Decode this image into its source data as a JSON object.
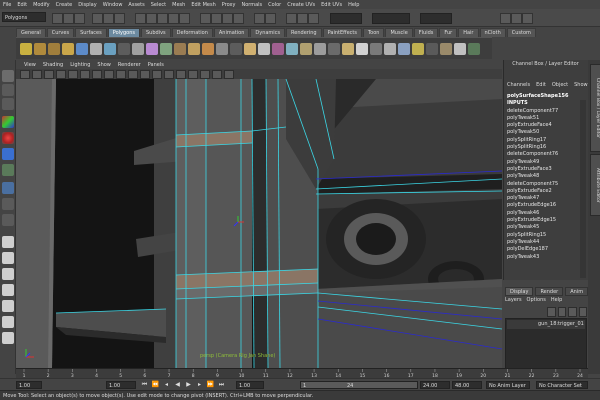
{
  "menubar": {
    "items": [
      "File",
      "Edit",
      "Modify",
      "Create",
      "Display",
      "Window",
      "Assets",
      "Select",
      "Mesh",
      "Edit Mesh",
      "Proxy",
      "Normals",
      "Color",
      "Create UVs",
      "Edit UVs",
      "Help"
    ]
  },
  "statusline": {
    "mode": "Polygons"
  },
  "shelf": {
    "tabs": [
      "General",
      "Curves",
      "Surfaces",
      "Polygons",
      "Subdivs",
      "Deformation",
      "Animation",
      "Dynamics",
      "Rendering",
      "PaintEffects",
      "Toon",
      "Muscle",
      "Fluids",
      "Fur",
      "Hair",
      "nCloth",
      "Custom"
    ],
    "active_tab": "Polygons"
  },
  "panel": {
    "menu": [
      "View",
      "Shading",
      "Lighting",
      "Show",
      "Renderer",
      "Panels"
    ],
    "camera_label": "persp (Camera Rig Jan Shane)"
  },
  "channel_box": {
    "title": "Channel Box / Layer Editor",
    "menu": [
      "Channels",
      "Edit",
      "Object",
      "Show"
    ],
    "shape": "polySurfaceShape156",
    "inputs_header": "INPUTS",
    "inputs": [
      "deleteComponent77",
      "polyTweak51",
      "polyExtrudeFace4",
      "polyTweak50",
      "polySplitRing17",
      "polySplitRing16",
      "deleteComponent76",
      "polyTweak49",
      "polyExtrudeFace3",
      "polyTweak48",
      "deleteComponent75",
      "polyExtrudeFace2",
      "polyTweak47",
      "polyExtrudeEdge16",
      "polyTweak46",
      "polyExtrudeEdge15",
      "polyTweak45",
      "polySplitRing15",
      "polyTweak44",
      "polyDelEdge187",
      "polyTweak43"
    ]
  },
  "side_tabs": [
    "Channel Box / Layer Editor",
    "Attribute Editor"
  ],
  "layer_editor": {
    "tabs": [
      "Display",
      "Render",
      "Anim"
    ],
    "active_tab": "Display",
    "menu": [
      "Layers",
      "Options",
      "Help"
    ],
    "layer_name": "gun_18:trigger_01"
  },
  "time_slider": {
    "ticks": [
      "1",
      "2",
      "3",
      "4",
      "5",
      "6",
      "7",
      "8",
      "9",
      "10",
      "11",
      "12",
      "13",
      "14",
      "15",
      "16",
      "17",
      "18",
      "19",
      "20",
      "21",
      "22",
      "23",
      "24"
    ]
  },
  "range_slider": {
    "start": "1.00",
    "current": "1.00",
    "range_start": "1.00",
    "range_min": "1",
    "range_max": "24",
    "range_end": "24.00",
    "end": "48.00",
    "anim_layer": "No Anim Layer",
    "char_set": "No Character Set"
  },
  "help_line": "Move Tool: Select an object(s) to move object(s). Use edit mode to change pivot (INSERT). Ctrl+LMB to move perpendicular.",
  "colors": {
    "accent": "#6c8aa0",
    "wireframe": "#3bd7e6",
    "camera_label": "#8fbf3a"
  }
}
